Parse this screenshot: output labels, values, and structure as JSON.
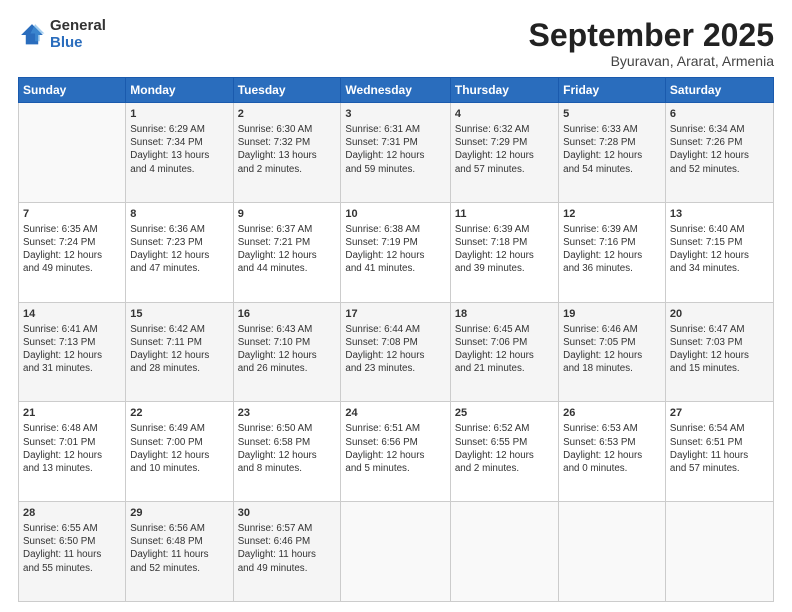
{
  "logo": {
    "general": "General",
    "blue": "Blue"
  },
  "header": {
    "title": "September 2025",
    "subtitle": "Byuravan, Ararat, Armenia"
  },
  "weekdays": [
    "Sunday",
    "Monday",
    "Tuesday",
    "Wednesday",
    "Thursday",
    "Friday",
    "Saturday"
  ],
  "weeks": [
    [
      {
        "day": "",
        "info": ""
      },
      {
        "day": "1",
        "info": "Sunrise: 6:29 AM\nSunset: 7:34 PM\nDaylight: 13 hours\nand 4 minutes."
      },
      {
        "day": "2",
        "info": "Sunrise: 6:30 AM\nSunset: 7:32 PM\nDaylight: 13 hours\nand 2 minutes."
      },
      {
        "day": "3",
        "info": "Sunrise: 6:31 AM\nSunset: 7:31 PM\nDaylight: 12 hours\nand 59 minutes."
      },
      {
        "day": "4",
        "info": "Sunrise: 6:32 AM\nSunset: 7:29 PM\nDaylight: 12 hours\nand 57 minutes."
      },
      {
        "day": "5",
        "info": "Sunrise: 6:33 AM\nSunset: 7:28 PM\nDaylight: 12 hours\nand 54 minutes."
      },
      {
        "day": "6",
        "info": "Sunrise: 6:34 AM\nSunset: 7:26 PM\nDaylight: 12 hours\nand 52 minutes."
      }
    ],
    [
      {
        "day": "7",
        "info": "Sunrise: 6:35 AM\nSunset: 7:24 PM\nDaylight: 12 hours\nand 49 minutes."
      },
      {
        "day": "8",
        "info": "Sunrise: 6:36 AM\nSunset: 7:23 PM\nDaylight: 12 hours\nand 47 minutes."
      },
      {
        "day": "9",
        "info": "Sunrise: 6:37 AM\nSunset: 7:21 PM\nDaylight: 12 hours\nand 44 minutes."
      },
      {
        "day": "10",
        "info": "Sunrise: 6:38 AM\nSunset: 7:19 PM\nDaylight: 12 hours\nand 41 minutes."
      },
      {
        "day": "11",
        "info": "Sunrise: 6:39 AM\nSunset: 7:18 PM\nDaylight: 12 hours\nand 39 minutes."
      },
      {
        "day": "12",
        "info": "Sunrise: 6:39 AM\nSunset: 7:16 PM\nDaylight: 12 hours\nand 36 minutes."
      },
      {
        "day": "13",
        "info": "Sunrise: 6:40 AM\nSunset: 7:15 PM\nDaylight: 12 hours\nand 34 minutes."
      }
    ],
    [
      {
        "day": "14",
        "info": "Sunrise: 6:41 AM\nSunset: 7:13 PM\nDaylight: 12 hours\nand 31 minutes."
      },
      {
        "day": "15",
        "info": "Sunrise: 6:42 AM\nSunset: 7:11 PM\nDaylight: 12 hours\nand 28 minutes."
      },
      {
        "day": "16",
        "info": "Sunrise: 6:43 AM\nSunset: 7:10 PM\nDaylight: 12 hours\nand 26 minutes."
      },
      {
        "day": "17",
        "info": "Sunrise: 6:44 AM\nSunset: 7:08 PM\nDaylight: 12 hours\nand 23 minutes."
      },
      {
        "day": "18",
        "info": "Sunrise: 6:45 AM\nSunset: 7:06 PM\nDaylight: 12 hours\nand 21 minutes."
      },
      {
        "day": "19",
        "info": "Sunrise: 6:46 AM\nSunset: 7:05 PM\nDaylight: 12 hours\nand 18 minutes."
      },
      {
        "day": "20",
        "info": "Sunrise: 6:47 AM\nSunset: 7:03 PM\nDaylight: 12 hours\nand 15 minutes."
      }
    ],
    [
      {
        "day": "21",
        "info": "Sunrise: 6:48 AM\nSunset: 7:01 PM\nDaylight: 12 hours\nand 13 minutes."
      },
      {
        "day": "22",
        "info": "Sunrise: 6:49 AM\nSunset: 7:00 PM\nDaylight: 12 hours\nand 10 minutes."
      },
      {
        "day": "23",
        "info": "Sunrise: 6:50 AM\nSunset: 6:58 PM\nDaylight: 12 hours\nand 8 minutes."
      },
      {
        "day": "24",
        "info": "Sunrise: 6:51 AM\nSunset: 6:56 PM\nDaylight: 12 hours\nand 5 minutes."
      },
      {
        "day": "25",
        "info": "Sunrise: 6:52 AM\nSunset: 6:55 PM\nDaylight: 12 hours\nand 2 minutes."
      },
      {
        "day": "26",
        "info": "Sunrise: 6:53 AM\nSunset: 6:53 PM\nDaylight: 12 hours\nand 0 minutes."
      },
      {
        "day": "27",
        "info": "Sunrise: 6:54 AM\nSunset: 6:51 PM\nDaylight: 11 hours\nand 57 minutes."
      }
    ],
    [
      {
        "day": "28",
        "info": "Sunrise: 6:55 AM\nSunset: 6:50 PM\nDaylight: 11 hours\nand 55 minutes."
      },
      {
        "day": "29",
        "info": "Sunrise: 6:56 AM\nSunset: 6:48 PM\nDaylight: 11 hours\nand 52 minutes."
      },
      {
        "day": "30",
        "info": "Sunrise: 6:57 AM\nSunset: 6:46 PM\nDaylight: 11 hours\nand 49 minutes."
      },
      {
        "day": "",
        "info": ""
      },
      {
        "day": "",
        "info": ""
      },
      {
        "day": "",
        "info": ""
      },
      {
        "day": "",
        "info": ""
      }
    ]
  ]
}
